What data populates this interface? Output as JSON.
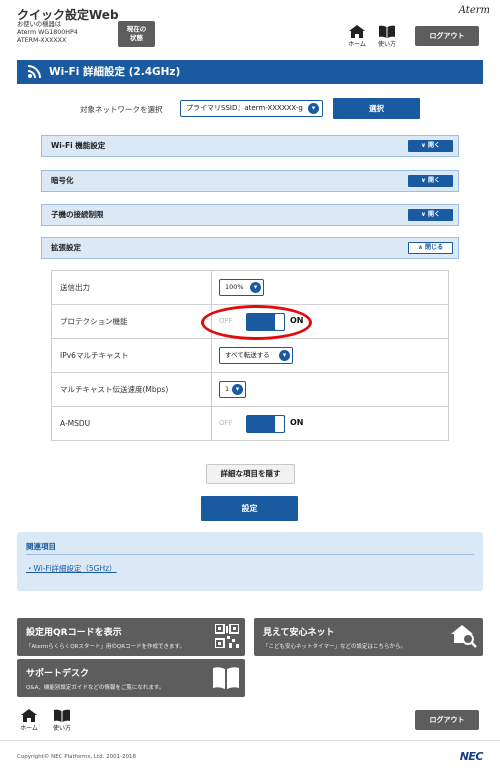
{
  "header": {
    "app_title": "クイック設定Web",
    "device_line1": "お使いの機器は",
    "device_line2": "Aterm WG1800HP4",
    "device_line3": "ATERM-XXXXXX",
    "status_line1": "現在の",
    "status_line2": "状態",
    "logo": "Aterm",
    "home_label": "ホーム",
    "help_label": "使い方",
    "logout_label": "ログアウト"
  },
  "page": {
    "title": "Wi-Fi 詳細設定 (2.4GHz)",
    "network_label": "対象ネットワークを選択",
    "network_value": "プライマリSSID：aterm-XXXXXX-g",
    "select_button": "選択"
  },
  "sections": [
    {
      "title": "Wi-Fi 機能設定",
      "button": "開く"
    },
    {
      "title": "暗号化",
      "button": "開く"
    },
    {
      "title": "子機の接続制限",
      "button": "開く"
    },
    {
      "title": "拡張設定",
      "button": "閉じる"
    }
  ],
  "settings": {
    "tx_power": {
      "label": "送信出力",
      "value": "100%"
    },
    "protection": {
      "label": "プロテクション機能",
      "off": "OFF",
      "on": "ON",
      "state": "ON"
    },
    "ipv6_multicast": {
      "label": "IPv6マルチキャスト",
      "value": "すべて転送する"
    },
    "multicast_rate": {
      "label": "マルチキャスト伝送速度(Mbps)",
      "value": "1"
    },
    "amsdu": {
      "label": "A-MSDU",
      "off": "OFF",
      "on": "ON",
      "state": "ON"
    }
  },
  "actions": {
    "hide_details": "詳細な項目を隠す",
    "apply": "設定"
  },
  "related": {
    "title": "関連項目",
    "link": "Wi-Fi詳細設定（5GHz）"
  },
  "tiles": {
    "qr_title": "設定用QRコードを表示",
    "qr_sub": "「AtermらくらくQRスタート」用のQRコードを作成できます。",
    "safe_title": "見えて安心ネット",
    "safe_sub": "「こども安心ネットタイマー」などの設定はこちらから。",
    "support_title": "サポートデスク",
    "support_sub": "Q&A、機能別設定ガイドなどの情報をご覧になれます。"
  },
  "footer": {
    "home_label": "ホーム",
    "help_label": "使い方",
    "logout_label": "ログアウト",
    "copyright": "Copyright© NEC Platforms, Ltd. 2001-2018",
    "brand": "NEC"
  },
  "colors": {
    "accent": "#1a5aa0",
    "panel": "#dbe9f7",
    "dark_button": "#5d5d5d",
    "highlight": "#e20a0a"
  }
}
